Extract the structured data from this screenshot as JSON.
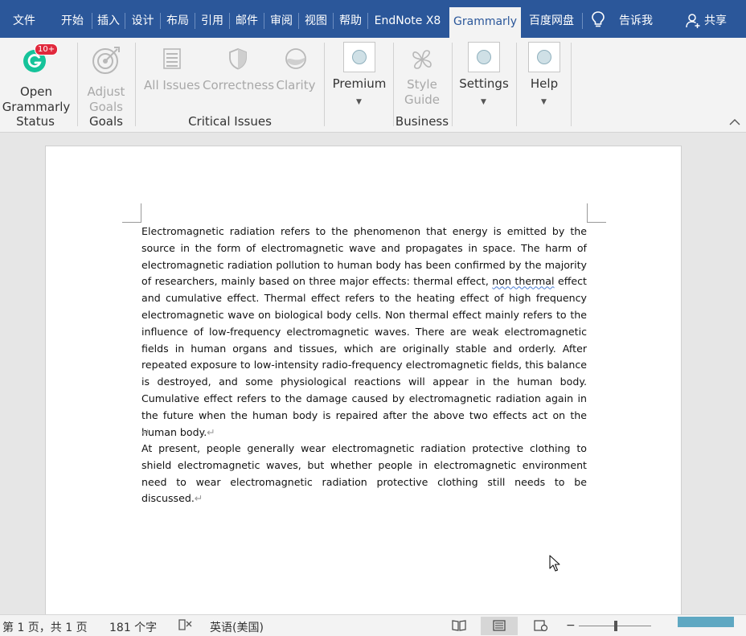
{
  "menu": {
    "tabs": [
      "文件",
      "开始",
      "插入",
      "设计",
      "布局",
      "引用",
      "邮件",
      "审阅",
      "视图",
      "帮助",
      "EndNote X8",
      "Grammarly",
      "百度网盘"
    ],
    "active": "Grammarly",
    "tell_me": "告诉我",
    "share": "共享"
  },
  "ribbon": {
    "open_grammarly": {
      "line1": "Open",
      "line2": "Grammarly",
      "badge": "10+"
    },
    "adjust_goals": {
      "line1": "Adjust",
      "line2": "Goals"
    },
    "all_issues": "All Issues",
    "correctness": "Correctness",
    "clarity": "Clarity",
    "premium": "Premium",
    "style_guide": {
      "line1": "Style",
      "line2": "Guide"
    },
    "settings": "Settings",
    "help": "Help",
    "groups": {
      "status": "Status",
      "goals": "Goals",
      "critical_issues": "Critical Issues",
      "business": "Business"
    }
  },
  "document": {
    "p1_a": "Electromagnetic radiation refers to the phenomenon that energy is emitted by the source in the form of electromagnetic wave and propagates in space. The harm of electromagnetic radiation pollution to human body has been confirmed by the majority of researchers, mainly based on three major effects: thermal effect, ",
    "p1_wavy": "non thermal",
    "p1_b": " effect and cumulative effect. Thermal effect refers to the heating effect of high frequency electromagnetic wave on biological body cells. Non thermal effect mainly refers to the influence of low-frequency electromagnetic waves. There are weak electromagnetic fields in human organs and tissues, which are originally stable and orderly. After repeated exposure to low-intensity radio-frequency electromagnetic fields, this balance is destroyed, and some physiological reactions will appear in the human body. Cumulative effect refers to the damage caused by electromagnetic radiation again in the future when the human body is repaired after the above two effects act on the human body.",
    "p2": "At present, people generally wear electromagnetic radiation protective clothing to shield electromagnetic waves, but whether people in electromagnetic environment need to wear electromagnetic radiation protective clothing still needs to be discussed.",
    "para_mark": "↵"
  },
  "status": {
    "page": "第 1 页，共 1 页",
    "words": "181 个字",
    "language": "英语(美国)",
    "zoom": "−"
  },
  "colors": {
    "accent": "#2b579a",
    "ribbon": "#f3f3f3",
    "grammarly_green": "#15c39a",
    "badge": "#e1283c"
  }
}
